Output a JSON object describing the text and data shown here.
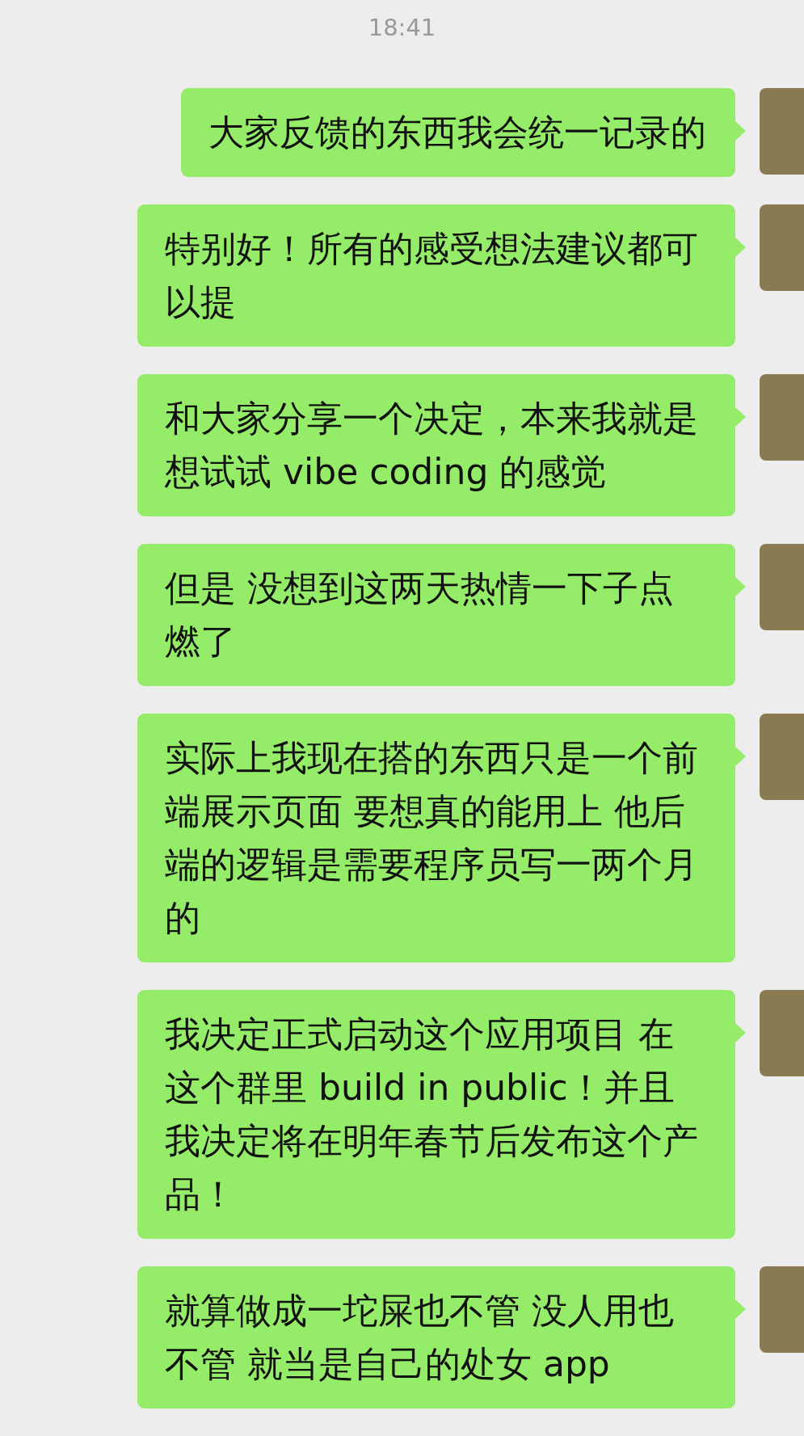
{
  "timestamp": "18:41",
  "messages": [
    {
      "text": "大家反馈的东西我会统一记录的"
    },
    {
      "text": "特别好！所有的感受想法建议都可以提"
    },
    {
      "text": "和大家分享一个决定，本来我就是想试试 vibe coding 的感觉"
    },
    {
      "text": "但是 没想到这两天热情一下子点燃了"
    },
    {
      "text": "实际上我现在搭的东西只是一个前端展示页面 要想真的能用上 他后端的逻辑是需要程序员写一两个月的"
    },
    {
      "text": "我决定正式启动这个应用项目 在这个群里 build in public！并且我决定将在明年春节后发布这个产品！"
    },
    {
      "text": "就算做成一坨屎也不管 没人用也不管 就当是自己的处女 app"
    }
  ]
}
